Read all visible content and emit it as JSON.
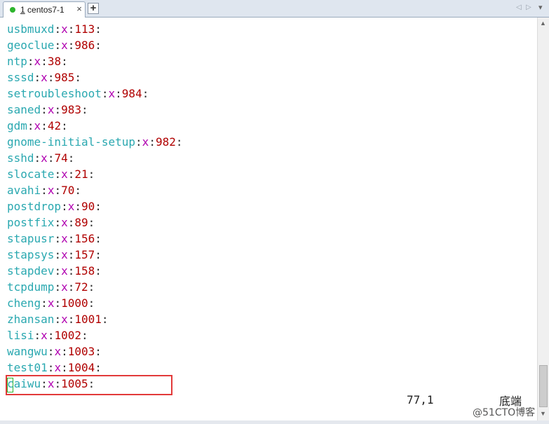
{
  "tab": {
    "number": "1",
    "name": "centos7-1",
    "close_glyph": "×",
    "status_color": "#2db52d"
  },
  "new_tab_label": "+",
  "nav": {
    "left": "◁",
    "right": "▷",
    "menu": "▾"
  },
  "terminal": {
    "lines": [
      {
        "name": "usbmuxd",
        "x": "x",
        "uid": "113"
      },
      {
        "name": "geoclue",
        "x": "x",
        "uid": "986"
      },
      {
        "name": "ntp",
        "x": "x",
        "uid": "38"
      },
      {
        "name": "sssd",
        "x": "x",
        "uid": "985"
      },
      {
        "name": "setroubleshoot",
        "x": "x",
        "uid": "984"
      },
      {
        "name": "saned",
        "x": "x",
        "uid": "983"
      },
      {
        "name": "gdm",
        "x": "x",
        "uid": "42"
      },
      {
        "name": "gnome-initial-setup",
        "x": "x",
        "uid": "982"
      },
      {
        "name": "sshd",
        "x": "x",
        "uid": "74"
      },
      {
        "name": "slocate",
        "x": "x",
        "uid": "21"
      },
      {
        "name": "avahi",
        "x": "x",
        "uid": "70"
      },
      {
        "name": "postdrop",
        "x": "x",
        "uid": "90"
      },
      {
        "name": "postfix",
        "x": "x",
        "uid": "89"
      },
      {
        "name": "stapusr",
        "x": "x",
        "uid": "156"
      },
      {
        "name": "stapsys",
        "x": "x",
        "uid": "157"
      },
      {
        "name": "stapdev",
        "x": "x",
        "uid": "158"
      },
      {
        "name": "tcpdump",
        "x": "x",
        "uid": "72"
      },
      {
        "name": "cheng",
        "x": "x",
        "uid": "1000"
      },
      {
        "name": "zhansan",
        "x": "x",
        "uid": "1001"
      },
      {
        "name": "lisi",
        "x": "x",
        "uid": "1002"
      },
      {
        "name": "wangwu",
        "x": "x",
        "uid": "1003"
      },
      {
        "name": "test01",
        "x": "x",
        "uid": "1004"
      },
      {
        "name": "caiwu",
        "x": "x",
        "uid": "1005"
      }
    ],
    "separator": ":",
    "cursor_position": "77,1",
    "file_position": "底端"
  },
  "watermark": "@51CTO博客",
  "colors": {
    "name": "#2aa8b0",
    "x": "#b000b0",
    "uid": "#b00000",
    "highlight": "#e23a3a",
    "cursor": "#2bb52b"
  },
  "scrollbar": {
    "up": "▲",
    "down": "▼"
  }
}
